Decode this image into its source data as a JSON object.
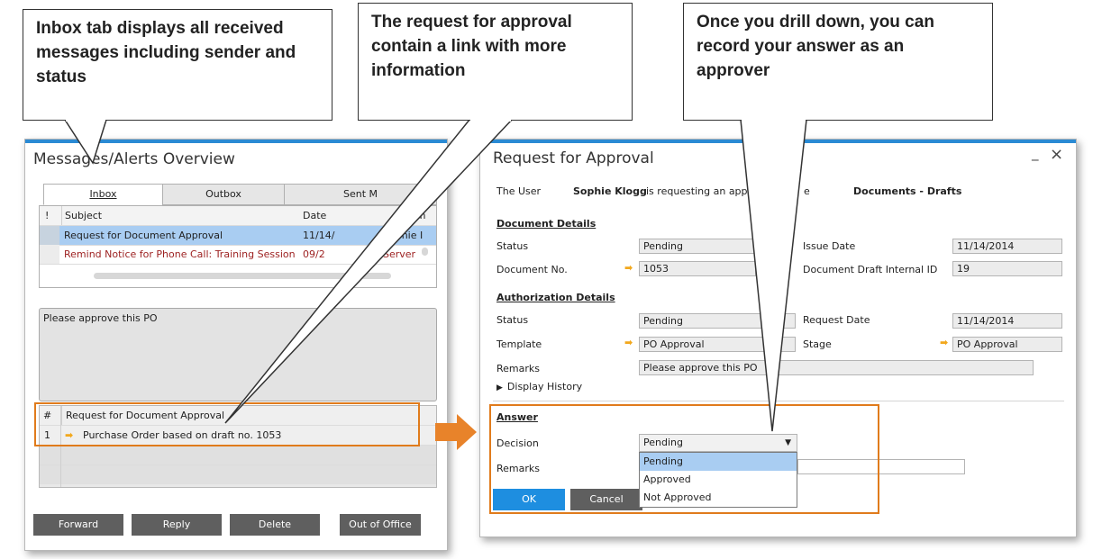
{
  "callouts": [
    "Inbox tab displays all received messages including sender and status",
    "The request for approval contain a link with more information",
    "Once you drill down, you can record your answer as an approver"
  ],
  "left_window": {
    "title": "Messages/Alerts Overview",
    "tabs": [
      "Inbox",
      "Outbox",
      "Sent M"
    ],
    "columns": {
      "flag": "!",
      "subject": "Subject",
      "date": "Date",
      "from": "om"
    },
    "rows": [
      {
        "subject": "Request for Document Approval",
        "date": "11/14/",
        "from": "Sophie I"
      },
      {
        "subject": "Remind Notice for Phone Call: Training Session",
        "date": "09/2",
        "from": "Server"
      }
    ],
    "message_text": "Please approve this PO",
    "link_table": {
      "header_num": "#",
      "header_text": "Request for Document Approval",
      "row_num": "1",
      "row_text": "Purchase Order based on draft no. 1053"
    },
    "buttons": [
      "Forward",
      "Reply",
      "Delete",
      "Out of Office"
    ]
  },
  "right_window": {
    "title": "Request for Approval",
    "minimize_glyph": "_",
    "close_glyph": "×",
    "user_label": "The User",
    "user_name": "Sophie Klogg",
    "user_text": "is requesting an appr",
    "user_text_tail": "e",
    "doc_type": "Documents - Drafts",
    "document_details": {
      "heading": "Document Details",
      "status_label": "Status",
      "status_value": "Pending",
      "doc_no_label": "Document No.",
      "doc_no_value": "1053",
      "issue_date_label": "Issue Date",
      "issue_date_value": "11/14/2014",
      "draft_id_label": "Document Draft Internal ID",
      "draft_id_value": "19"
    },
    "authorization_details": {
      "heading": "Authorization Details",
      "status_label": "Status",
      "status_value": "Pending",
      "template_label": "Template",
      "template_value": "PO Approval",
      "remarks_label": "Remarks",
      "remarks_value": "Please approve this PO",
      "request_date_label": "Request Date",
      "request_date_value": "11/14/2014",
      "stage_label": "Stage",
      "stage_value": "PO Approval"
    },
    "display_history": "Display History",
    "answer": {
      "heading": "Answer",
      "decision_label": "Decision",
      "decision_value": "Pending",
      "remarks_label": "Remarks",
      "options": [
        "Pending",
        "Approved",
        "Not Approved"
      ]
    },
    "buttons": {
      "ok": "OK",
      "cancel": "Cancel"
    }
  },
  "colors": {
    "highlight_orange": "#e07b1c",
    "selected_row": "#a9cdf2",
    "alert_text": "#9c1f1f",
    "ok_button": "#1e8ee0"
  }
}
